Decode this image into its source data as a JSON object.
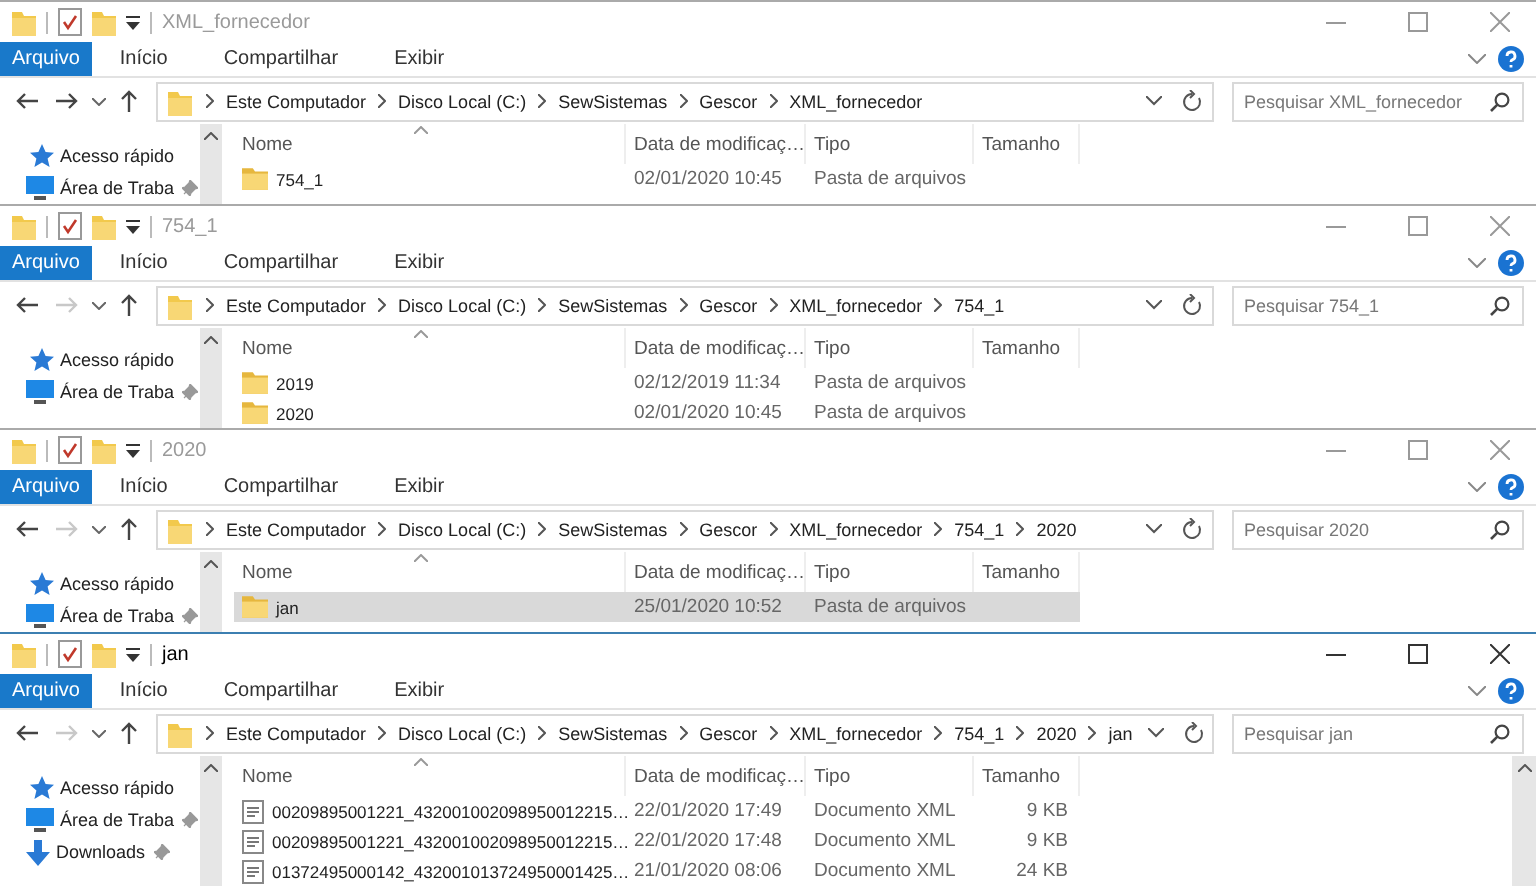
{
  "windows": [
    {
      "title": "XML_fornecedor",
      "active": false,
      "forward_disabled": false,
      "tabs": [
        {
          "label": "Arquivo",
          "kind": "file"
        },
        {
          "label": "Início",
          "kind": "tab"
        },
        {
          "label": "Compartilhar",
          "kind": "tab"
        },
        {
          "label": "Exibir",
          "kind": "tab"
        }
      ],
      "breadcrumbs": [
        "Este Computador",
        "Disco Local (C:)",
        "SewSistemas",
        "Gescor",
        "XML_fornecedor"
      ],
      "search": {
        "placeholder": "Pesquisar XML_fornecedor"
      },
      "sidebar": [
        {
          "label": "Acesso rápido",
          "kind": "star",
          "pinned": false
        },
        {
          "label": "Área de Traba",
          "kind": "desktop",
          "pinned": true
        }
      ],
      "columns": [
        "Nome",
        "Data de modificaç…",
        "Tipo",
        "Tamanho"
      ],
      "rows": [
        {
          "name": "754_1",
          "date": "02/01/2020 10:45",
          "type": "Pasta de arquivos",
          "kind": "folder",
          "selected": false
        }
      ]
    },
    {
      "title": "754_1",
      "active": false,
      "forward_disabled": true,
      "tabs": [
        {
          "label": "Arquivo",
          "kind": "file"
        },
        {
          "label": "Início",
          "kind": "tab"
        },
        {
          "label": "Compartilhar",
          "kind": "tab"
        },
        {
          "label": "Exibir",
          "kind": "tab"
        }
      ],
      "breadcrumbs": [
        "Este Computador",
        "Disco Local (C:)",
        "SewSistemas",
        "Gescor",
        "XML_fornecedor",
        "754_1"
      ],
      "search": {
        "placeholder": "Pesquisar 754_1"
      },
      "sidebar": [
        {
          "label": "Acesso rápido",
          "kind": "star",
          "pinned": false
        },
        {
          "label": "Área de Traba",
          "kind": "desktop",
          "pinned": true
        }
      ],
      "columns": [
        "Nome",
        "Data de modificaç…",
        "Tipo",
        "Tamanho"
      ],
      "rows": [
        {
          "name": "2019",
          "date": "02/12/2019 11:34",
          "type": "Pasta de arquivos",
          "kind": "folder",
          "selected": false
        },
        {
          "name": "2020",
          "date": "02/01/2020 10:45",
          "type": "Pasta de arquivos",
          "kind": "folder",
          "selected": false
        }
      ]
    },
    {
      "title": "2020",
      "active": false,
      "forward_disabled": true,
      "tabs": [
        {
          "label": "Arquivo",
          "kind": "file"
        },
        {
          "label": "Início",
          "kind": "tab"
        },
        {
          "label": "Compartilhar",
          "kind": "tab"
        },
        {
          "label": "Exibir",
          "kind": "tab"
        }
      ],
      "breadcrumbs": [
        "Este Computador",
        "Disco Local (C:)",
        "SewSistemas",
        "Gescor",
        "XML_fornecedor",
        "754_1",
        "2020"
      ],
      "search": {
        "placeholder": "Pesquisar 2020"
      },
      "sidebar": [
        {
          "label": "Acesso rápido",
          "kind": "star",
          "pinned": false
        },
        {
          "label": "Área de Traba",
          "kind": "desktop",
          "pinned": true
        }
      ],
      "columns": [
        "Nome",
        "Data de modificaç…",
        "Tipo",
        "Tamanho"
      ],
      "rows": [
        {
          "name": "jan",
          "date": "25/01/2020 10:52",
          "type": "Pasta de arquivos",
          "kind": "folder",
          "selected": true
        }
      ]
    },
    {
      "title": "jan",
      "active": true,
      "forward_disabled": true,
      "tabs": [
        {
          "label": "Arquivo",
          "kind": "file"
        },
        {
          "label": "Início",
          "kind": "tab"
        },
        {
          "label": "Compartilhar",
          "kind": "tab"
        },
        {
          "label": "Exibir",
          "kind": "tab"
        }
      ],
      "breadcrumbs": [
        "Este Computador",
        "Disco Local (C:)",
        "SewSistemas",
        "Gescor",
        "XML_fornecedor",
        "754_1",
        "2020",
        "jan"
      ],
      "search": {
        "placeholder": "Pesquisar jan"
      },
      "sidebar": [
        {
          "label": "Acesso rápido",
          "kind": "star",
          "pinned": false
        },
        {
          "label": "Área de Traba",
          "kind": "desktop",
          "pinned": true
        },
        {
          "label": "Downloads",
          "kind": "downloads",
          "pinned": true
        }
      ],
      "columns": [
        "Nome",
        "Data de modificaç…",
        "Tipo",
        "Tamanho"
      ],
      "rows": [
        {
          "name": "00209895001221_432001002098950012215…",
          "date": "22/01/2020 17:49",
          "type": "Documento XML",
          "size": "9 KB",
          "kind": "xml",
          "selected": false
        },
        {
          "name": "00209895001221_432001002098950012215…",
          "date": "22/01/2020 17:48",
          "type": "Documento XML",
          "size": "9 KB",
          "kind": "xml",
          "selected": false
        },
        {
          "name": "01372495000142_432001013724950001425…",
          "date": "21/01/2020 08:06",
          "type": "Documento XML",
          "size": "24 KB",
          "kind": "xml",
          "selected": false
        }
      ]
    }
  ]
}
